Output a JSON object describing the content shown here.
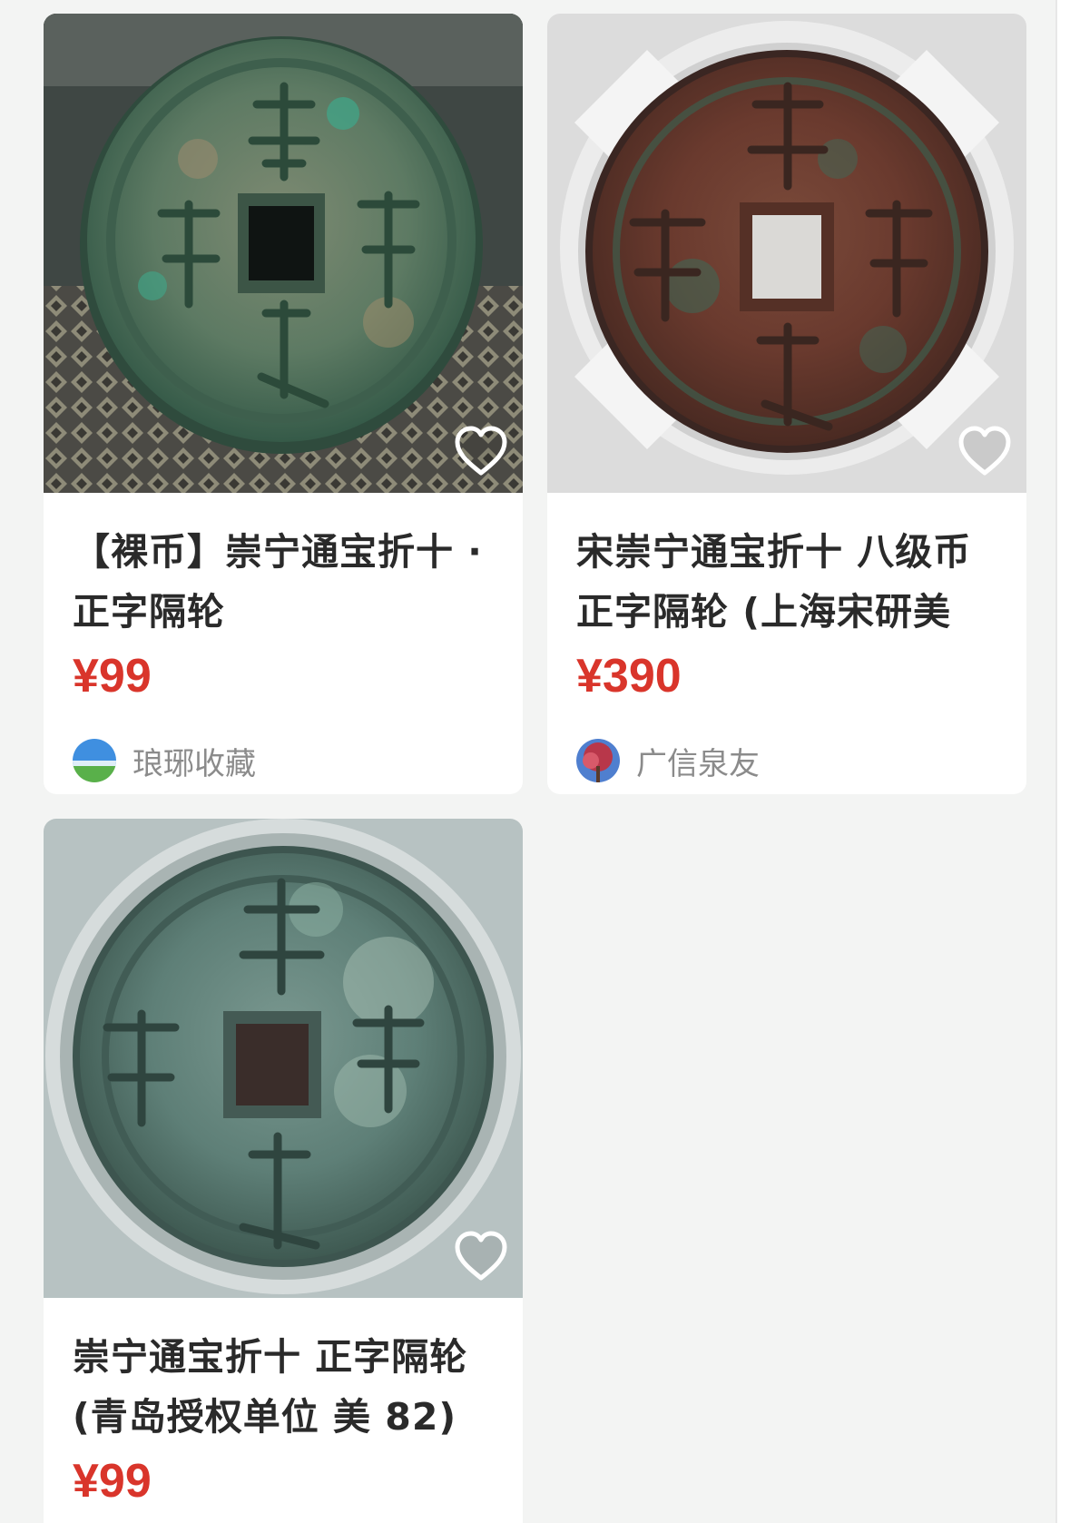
{
  "products": [
    {
      "title": "【裸币】崇宁通宝折十 · 正字隔轮",
      "price": "¥99",
      "seller": "琅琊收藏",
      "image_icon": "coin-photo-green",
      "avatar_icon": "sky-landscape-avatar"
    },
    {
      "title": "宋崇宁通宝折十 八级币 正字隔轮 (上海宋研美",
      "price": "¥390",
      "seller": "广信泉友",
      "image_icon": "coin-photo-slab-red",
      "avatar_icon": "tree-avatar"
    },
    {
      "title": "崇宁通宝折十 正字隔轮 (青岛授权单位 美 82)",
      "price": "¥99",
      "image_icon": "coin-photo-capsule-green"
    }
  ],
  "colors": {
    "price": "#d9352b",
    "background": "#f3f4f3",
    "card": "#ffffff",
    "title": "#2a2a2a",
    "seller": "#8b8b8b"
  },
  "icons": {
    "favorite": "heart-outline-icon"
  }
}
